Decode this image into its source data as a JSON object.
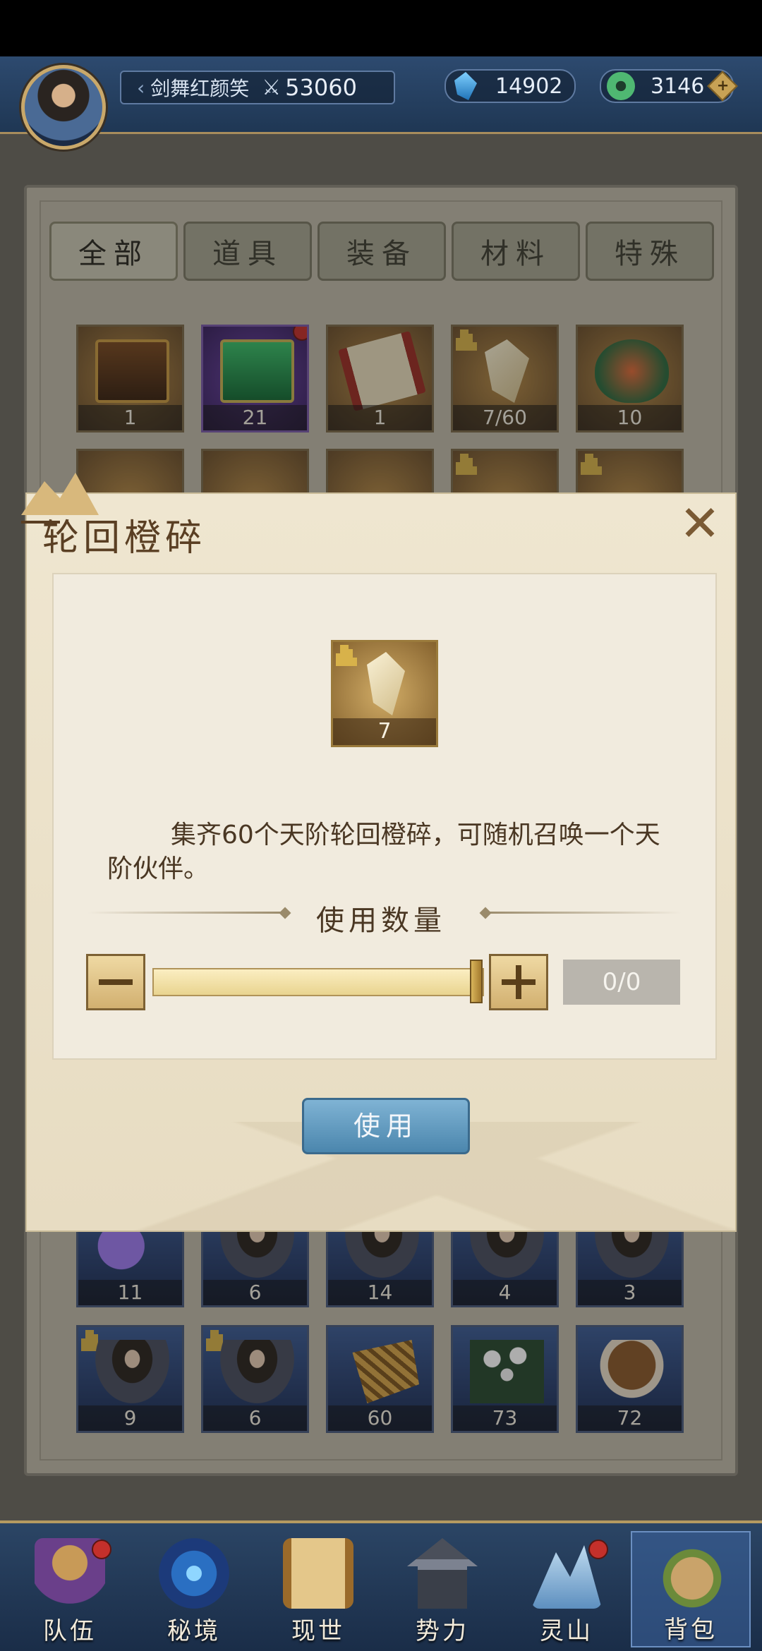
{
  "header": {
    "player_name": "剑舞红颜笑",
    "power": "53060",
    "crystals": "14902",
    "jade": "3146"
  },
  "tabs": [
    {
      "label": "全部",
      "active": true
    },
    {
      "label": "道具",
      "active": false
    },
    {
      "label": "装备",
      "active": false
    },
    {
      "label": "材料",
      "active": false
    },
    {
      "label": "特殊",
      "active": false
    }
  ],
  "grid": {
    "row1": [
      {
        "icon": "treasure-chest",
        "count": "1"
      },
      {
        "icon": "jade-box",
        "count": "21",
        "badge": true
      },
      {
        "icon": "scroll",
        "count": "1"
      },
      {
        "icon": "reincarnation-shard",
        "count": "7/60"
      },
      {
        "icon": "spirit-egg",
        "count": "10"
      }
    ],
    "row_lower": [
      {
        "icon": "crescent-moon",
        "count": "11"
      },
      {
        "icon": "warrior-portrait",
        "count": "6"
      },
      {
        "icon": "elf-portrait",
        "count": "14"
      },
      {
        "icon": "maiden-portrait",
        "count": "4"
      },
      {
        "icon": "lady-portrait",
        "count": "3"
      }
    ],
    "row_bottom": [
      {
        "icon": "swordsman-portrait",
        "count": "9"
      },
      {
        "icon": "scholar-portrait",
        "count": "6"
      },
      {
        "icon": "ginseng-roots",
        "count": "60"
      },
      {
        "icon": "white-flowers",
        "count": "73"
      },
      {
        "icon": "lingzhi-mushroom",
        "count": "72"
      }
    ]
  },
  "dialog": {
    "title": "轮回橙碎",
    "item_count": "7",
    "description": "集齐60个天阶轮回橙碎，可随机召唤一个天阶伙伴。",
    "quantity_label": "使用数量",
    "quantity_readout": "0/0",
    "use_label": "使用"
  },
  "nav": [
    {
      "label": "队伍",
      "badge": true
    },
    {
      "label": "秘境",
      "badge": false
    },
    {
      "label": "现世",
      "badge": false
    },
    {
      "label": "势力",
      "badge": false
    },
    {
      "label": "灵山",
      "badge": true
    },
    {
      "label": "背包",
      "badge": false,
      "active": true
    }
  ]
}
